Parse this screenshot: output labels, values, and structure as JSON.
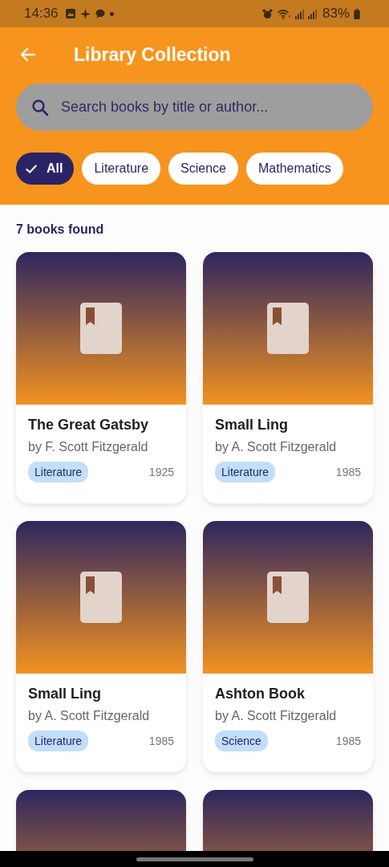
{
  "status_bar": {
    "time": "14:36",
    "battery": "83%"
  },
  "app_bar": {
    "title": "Library Collection"
  },
  "search": {
    "placeholder": "Search books by title or author..."
  },
  "filters": [
    {
      "label": "All",
      "selected": true
    },
    {
      "label": "Literature",
      "selected": false
    },
    {
      "label": "Science",
      "selected": false
    },
    {
      "label": "Mathematics",
      "selected": false
    }
  ],
  "result_count": "7 books found",
  "books": [
    {
      "kind": "full",
      "title": "The Great Gatsby",
      "author": "by F. Scott Fitzgerald",
      "category": "Literature",
      "year": "1925"
    },
    {
      "kind": "full",
      "title": "Small Ling",
      "author": "by A. Scott Fitzgerald",
      "category": "Literature",
      "year": "1985"
    },
    {
      "kind": "full",
      "title": "Small Ling",
      "author": "by A. Scott Fitzgerald",
      "category": "Literature",
      "year": "1985"
    },
    {
      "kind": "full",
      "title": "Ashton Book",
      "author": "by A. Scott Fitzgerald",
      "category": "Science",
      "year": "1985"
    },
    {
      "kind": "cover-only"
    },
    {
      "kind": "cover-only"
    }
  ]
}
